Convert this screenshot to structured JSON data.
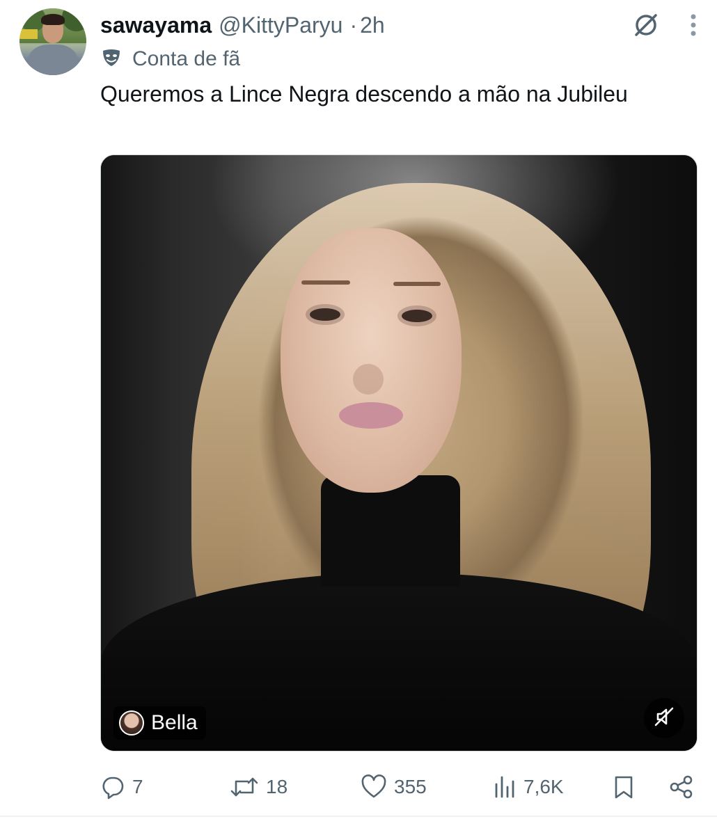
{
  "tweet": {
    "author_name": "sawayama",
    "author_handle": "@KittyParyu",
    "separator": "·",
    "time": "2h",
    "label": "Conta de fã",
    "text": "Queremos a Lince Negra descendo a mão na Jubileu"
  },
  "media": {
    "badge_name": "Bella",
    "muted": true
  },
  "actions": {
    "replies": "7",
    "retweets": "18",
    "likes": "355",
    "views": "7,6K"
  },
  "icons": {
    "top_right": [
      "grok-icon",
      "more-icon"
    ],
    "label": "theater-mask-icon",
    "action_bar": [
      "reply-icon",
      "retweet-icon",
      "like-icon",
      "views-icon",
      "bookmark-icon",
      "share-icon"
    ],
    "media": [
      "muted-speaker-icon"
    ]
  },
  "colors": {
    "text_primary": "#0f1419",
    "text_secondary": "#536471",
    "divider": "#eff3f4"
  }
}
